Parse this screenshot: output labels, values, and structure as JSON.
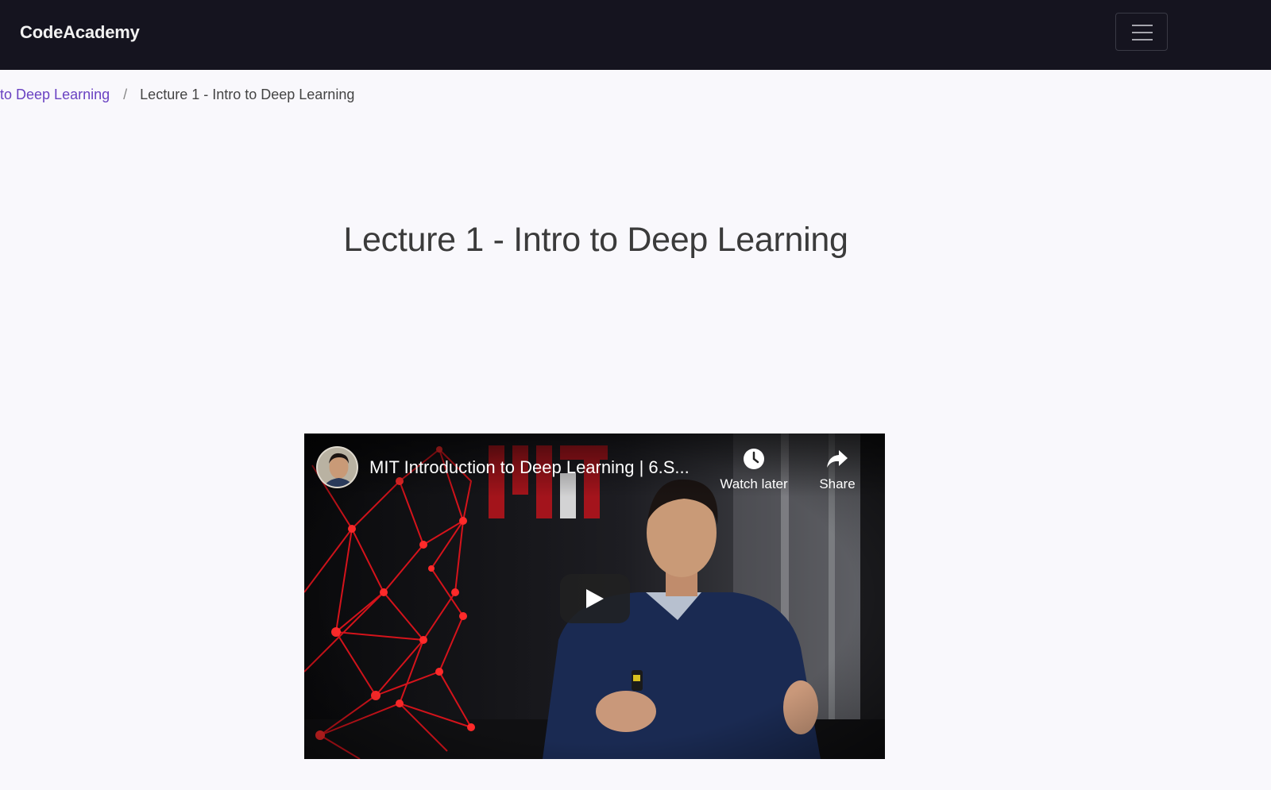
{
  "navbar": {
    "brand": "CodeAcademy",
    "menu_icon": "hamburger-menu-icon"
  },
  "breadcrumb": {
    "parent": "n to Deep Learning",
    "separator": "/",
    "current": "Lecture 1 - Intro to Deep Learning"
  },
  "page": {
    "title": "Lecture 1 - Intro to Deep Learning"
  },
  "video": {
    "title": "MIT Introduction to Deep Learning | 6.S...",
    "watch_later_label": "Watch later",
    "share_label": "Share",
    "watch_later_icon": "clock-icon",
    "share_icon": "share-arrow-icon",
    "play_icon": "play-icon"
  },
  "colors": {
    "navbar_bg": "#15141f",
    "page_bg": "#f9f8fc",
    "link": "#6a42c2",
    "mit_red": "#b3141c"
  }
}
